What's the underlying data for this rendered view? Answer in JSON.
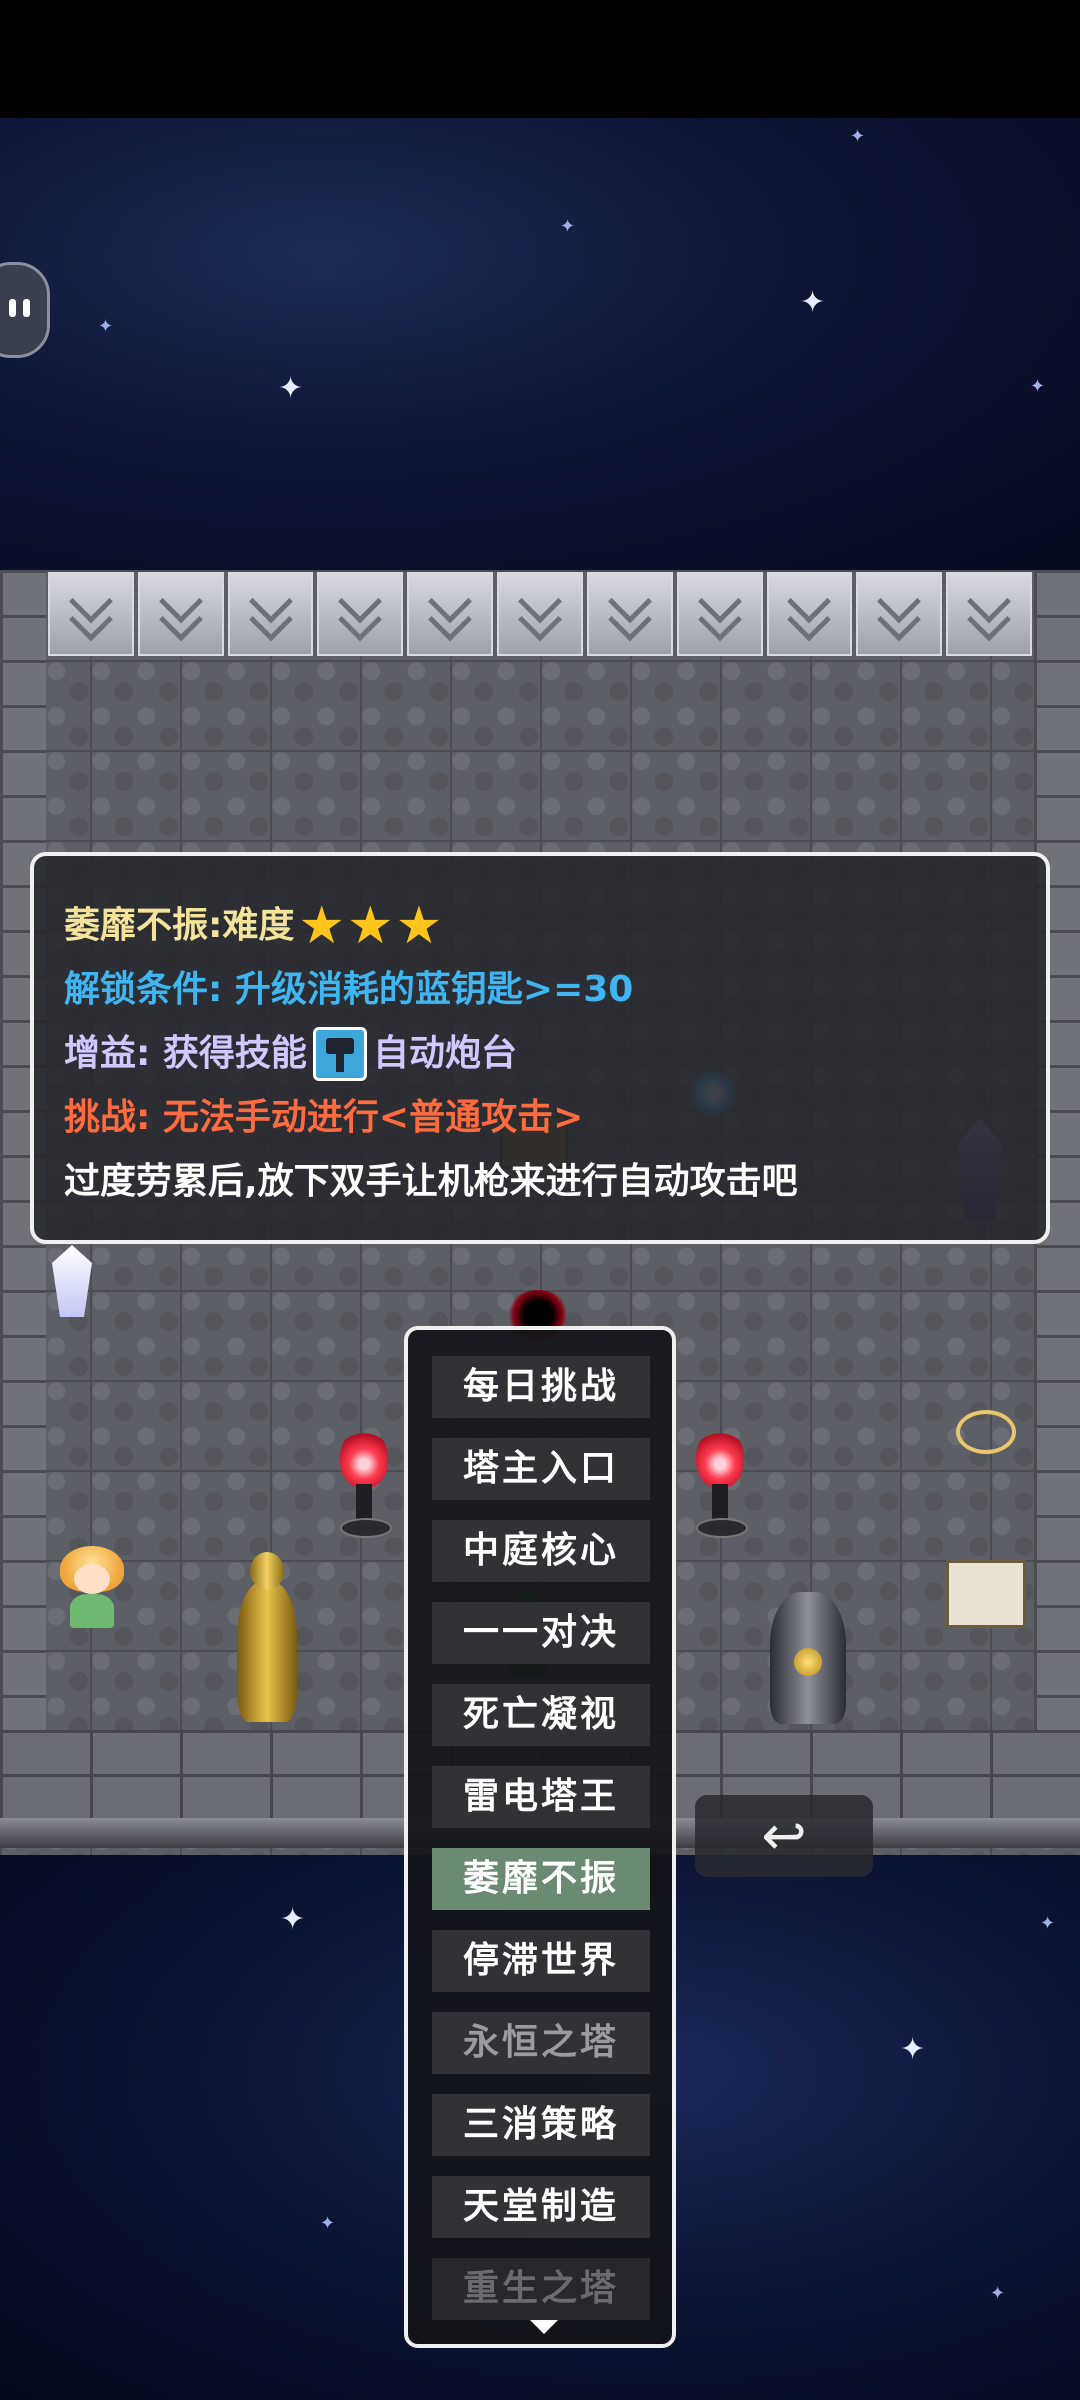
{
  "info_panel": {
    "title": "萎靡不振:难度",
    "difficulty_stars": "★★★",
    "unlock_condition": "解锁条件: 升级消耗的蓝钥匙>=30",
    "gain_prefix": "增益: 获得技能",
    "gain_skill_icon": "auto-turret-icon",
    "gain_skill_name": "自动炮台",
    "challenge": "挑战: 无法手动进行<普通攻击>",
    "flavor": "过度劳累后,放下双手让机枪来进行自动攻击吧"
  },
  "challenge_menu": {
    "items": [
      {
        "label": "每日挑战"
      },
      {
        "label": "塔主入口"
      },
      {
        "label": "中庭核心"
      },
      {
        "label": "一一对决"
      },
      {
        "label": "死亡凝视"
      },
      {
        "label": "雷电塔王"
      },
      {
        "label": "萎靡不振",
        "selected": true
      },
      {
        "label": "停滞世界"
      },
      {
        "label": "永恒之塔"
      },
      {
        "label": "三消策略"
      },
      {
        "label": "天堂制造"
      },
      {
        "label": "重生之塔"
      }
    ],
    "more_indicator": "chevron-down-icon"
  },
  "back_button": {
    "icon": "undo-arrow-icon",
    "glyph": "↩"
  },
  "colors": {
    "title": "#f4e39a",
    "unlock": "#3fb6f2",
    "gain": "#d2c8ff",
    "challenge": "#ff6b3f",
    "stars": "#ffc51a",
    "menu_selected": "#6b8a72"
  }
}
